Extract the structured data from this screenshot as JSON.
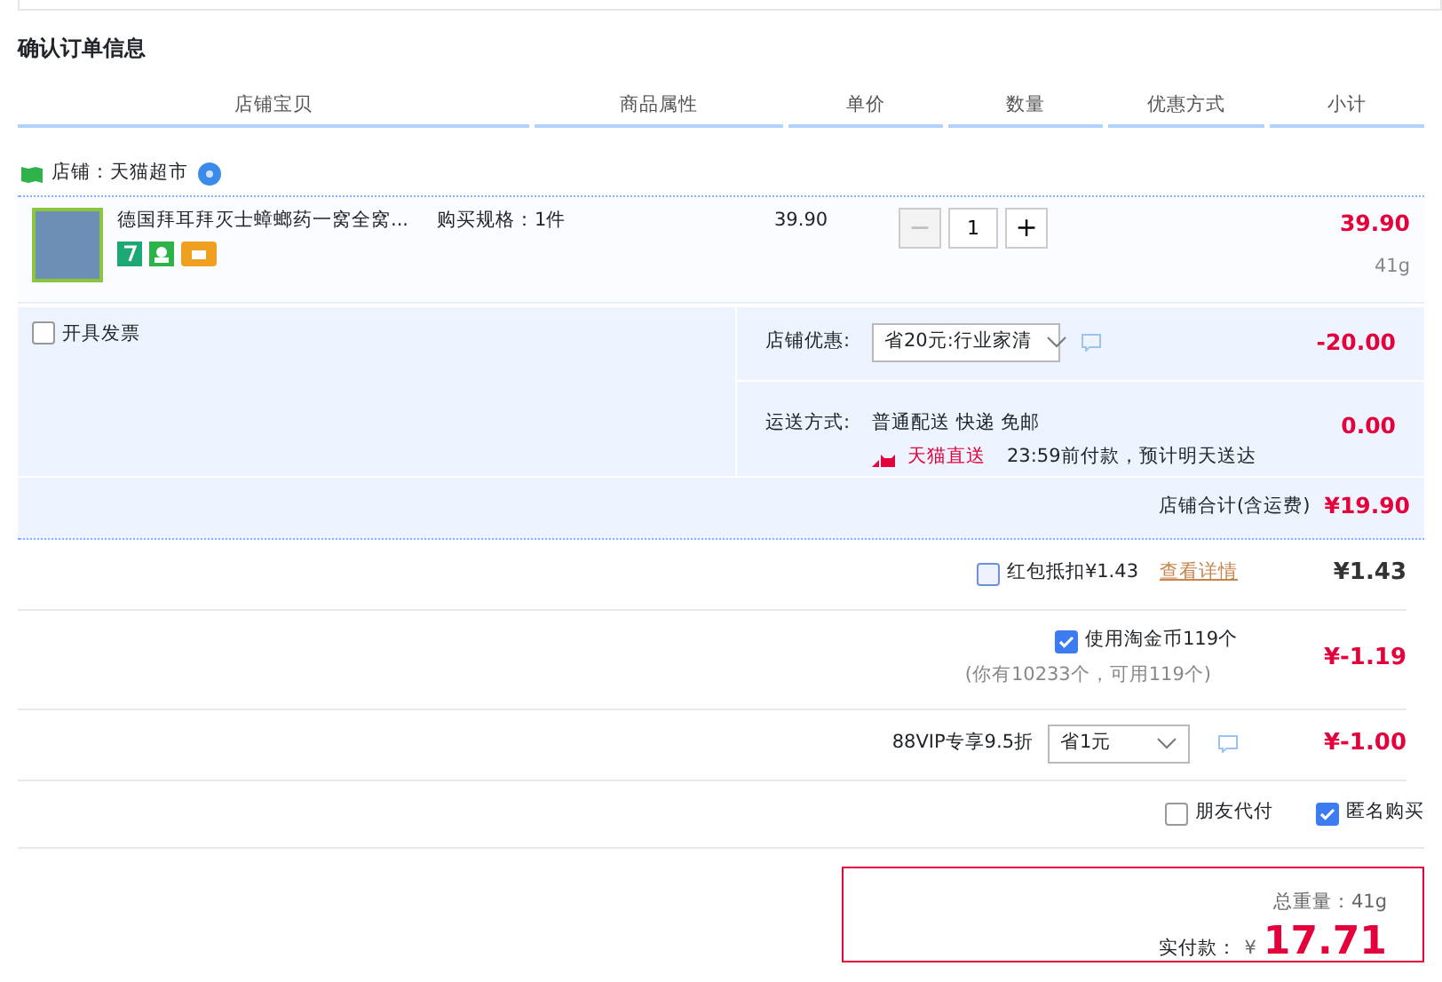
{
  "page_title": "确认订单信息",
  "columns": [
    "店铺宝贝",
    "商品属性",
    "单价",
    "数量",
    "优惠方式",
    "小计"
  ],
  "shop": {
    "label": "店铺：天猫超市"
  },
  "item": {
    "title": "德国拜耳拜灭士蟑螂药一窝全窝...",
    "spec": "购买规格：1件",
    "unit_price": "39.90",
    "minus": "−",
    "minus_disabled": true,
    "quantity": "1",
    "plus": "+",
    "subtotal": "39.90",
    "weight": "41g"
  },
  "invoice": {
    "label": "开具发票",
    "checked": false
  },
  "store_discount": {
    "label": "店铺优惠:",
    "value": "省20元:行业家清",
    "amount": "-20.00"
  },
  "shipping": {
    "label": "运送方式:",
    "method": "普通配送 快递 免邮",
    "badge": "天猫直送",
    "note": "23:59前付款，预计明天送达",
    "amount": "0.00"
  },
  "shop_total": {
    "label": "店铺合计(含运费)",
    "amount": "¥19.90"
  },
  "adjustments": [
    {
      "kind": "checkbox",
      "label": "红包抵扣¥1.43",
      "link": "查看详情",
      "checked": false,
      "amount": "¥1.43"
    },
    {
      "kind": "checkbox",
      "label": "使用淘金币119个",
      "note": "(你有10233个，可用119个)",
      "checked": true,
      "amount": "¥-1.19"
    },
    {
      "kind": "select",
      "label": "88VIP专享9.5折",
      "value": "省1元",
      "amount": "¥-1.00"
    }
  ],
  "options": [
    {
      "label": "朋友代付",
      "checked": false
    },
    {
      "label": "匿名购买",
      "checked": true
    }
  ],
  "summary": {
    "weight": "总重量：41g",
    "pay_label": "实付款：",
    "currency": "¥",
    "total": "17.71"
  }
}
